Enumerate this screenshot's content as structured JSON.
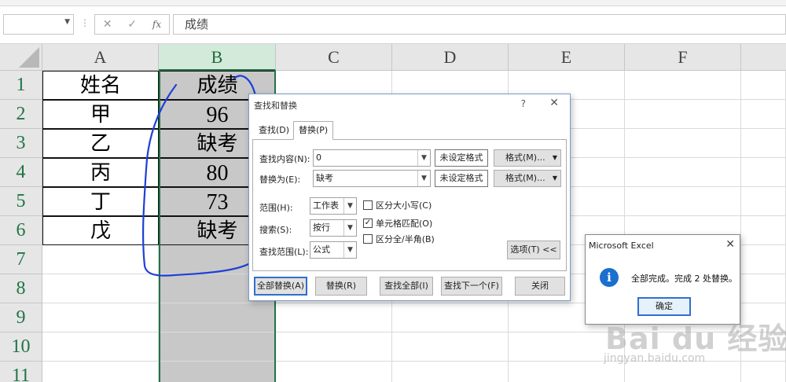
{
  "formula_bar": {
    "name_box_value": "",
    "cancel_symbol": "✕",
    "enter_symbol": "✓",
    "fx_label": "fx",
    "formula_value": "成绩"
  },
  "sheet": {
    "columns": [
      "A",
      "B",
      "C",
      "D",
      "E",
      "F"
    ],
    "rows": [
      "1",
      "2",
      "3",
      "4",
      "5",
      "6",
      "7",
      "8",
      "9",
      "10",
      "11"
    ],
    "cells": {
      "A1": "姓名",
      "B1": "成绩",
      "A2": "甲",
      "B2": "96",
      "A3": "乙",
      "B3": "缺考",
      "A4": "丙",
      "B4": "80",
      "A5": "丁",
      "B5": "73",
      "A6": "戊",
      "B6": "缺考"
    },
    "selected_column": "B"
  },
  "find_replace": {
    "title": "查找和替换",
    "help": "?",
    "close": "✕",
    "tabs": [
      "查找(D)",
      "替换(P)"
    ],
    "active_tab": "替换(P)",
    "find_label": "查找内容(N):",
    "find_value": "0",
    "replace_label": "替换为(E):",
    "replace_value": "缺考",
    "no_format": "未设定格式",
    "format_btn": "格式(M)...",
    "within_label": "范围(H):",
    "within_value": "工作表",
    "search_label": "搜索(S):",
    "search_value": "按行",
    "lookin_label": "查找范围(L):",
    "lookin_value": "公式",
    "match_case": "区分大小写(C)",
    "match_case_checked": false,
    "match_entire": "单元格匹配(O)",
    "match_entire_checked": true,
    "match_byte": "区分全/半角(B)",
    "match_byte_checked": false,
    "options_btn": "选项(T) <<",
    "replace_all": "全部替换(A)",
    "replace": "替换(R)",
    "find_all": "查找全部(I)",
    "find_next": "查找下一个(F)",
    "close_btn": "关闭"
  },
  "message_box": {
    "title": "Microsoft Excel",
    "close": "✕",
    "text": "全部完成。完成 2 处替换。",
    "ok": "确定"
  },
  "watermark": {
    "logo": "Bai du 经验",
    "url": "jingyan.baidu.com"
  },
  "colors": {
    "excel_green": "#217346",
    "selected_header": "#d3eadb",
    "selected_fill": "#c8c8c8",
    "annotation_pen": "#1f3fd6",
    "info_blue": "#1a6fcf"
  }
}
